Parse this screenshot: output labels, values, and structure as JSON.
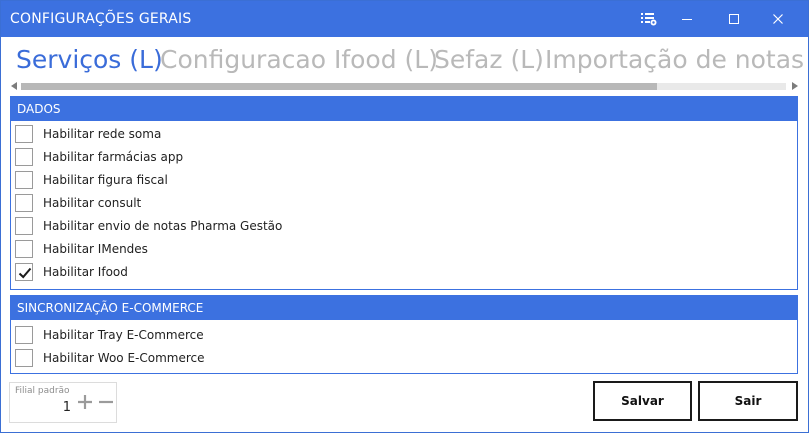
{
  "window": {
    "title": "CONFIGURAÇÕES GERAIS",
    "accent_color": "#3c71e0",
    "controls": {
      "settings_icon": "list-settings-icon",
      "minimize_icon": "minimize-icon",
      "maximize_icon": "maximize-icon",
      "close_icon": "close-icon"
    }
  },
  "tabs": [
    {
      "label": "Serviços (L)",
      "active": true
    },
    {
      "label": "Configuracao Ifood (L)",
      "active": false
    },
    {
      "label": "Sefaz (L)",
      "active": false
    },
    {
      "label": "Importação de notas",
      "active": false
    }
  ],
  "groups": {
    "dados": {
      "header": "DADOS",
      "items": [
        {
          "label": "Habilitar rede soma",
          "checked": false
        },
        {
          "label": "Habilitar farmácias app",
          "checked": false
        },
        {
          "label": "Habilitar figura fiscal",
          "checked": false
        },
        {
          "label": "Habilitar consult",
          "checked": false
        },
        {
          "label": "Habilitar envio de notas Pharma Gestão",
          "checked": false
        },
        {
          "label": "Habilitar IMendes",
          "checked": false
        },
        {
          "label": "Habilitar Ifood",
          "checked": true
        }
      ]
    },
    "ecommerce": {
      "header": "SINCRONIZAÇÃO E-COMMERCE",
      "items": [
        {
          "label": "Habilitar Tray E-Commerce",
          "checked": false
        },
        {
          "label": "Habilitar Woo E-Commerce",
          "checked": false
        }
      ]
    }
  },
  "footer": {
    "filial_label": "Filial padrão",
    "filial_value": "1",
    "save_label": "Salvar",
    "exit_label": "Sair"
  }
}
